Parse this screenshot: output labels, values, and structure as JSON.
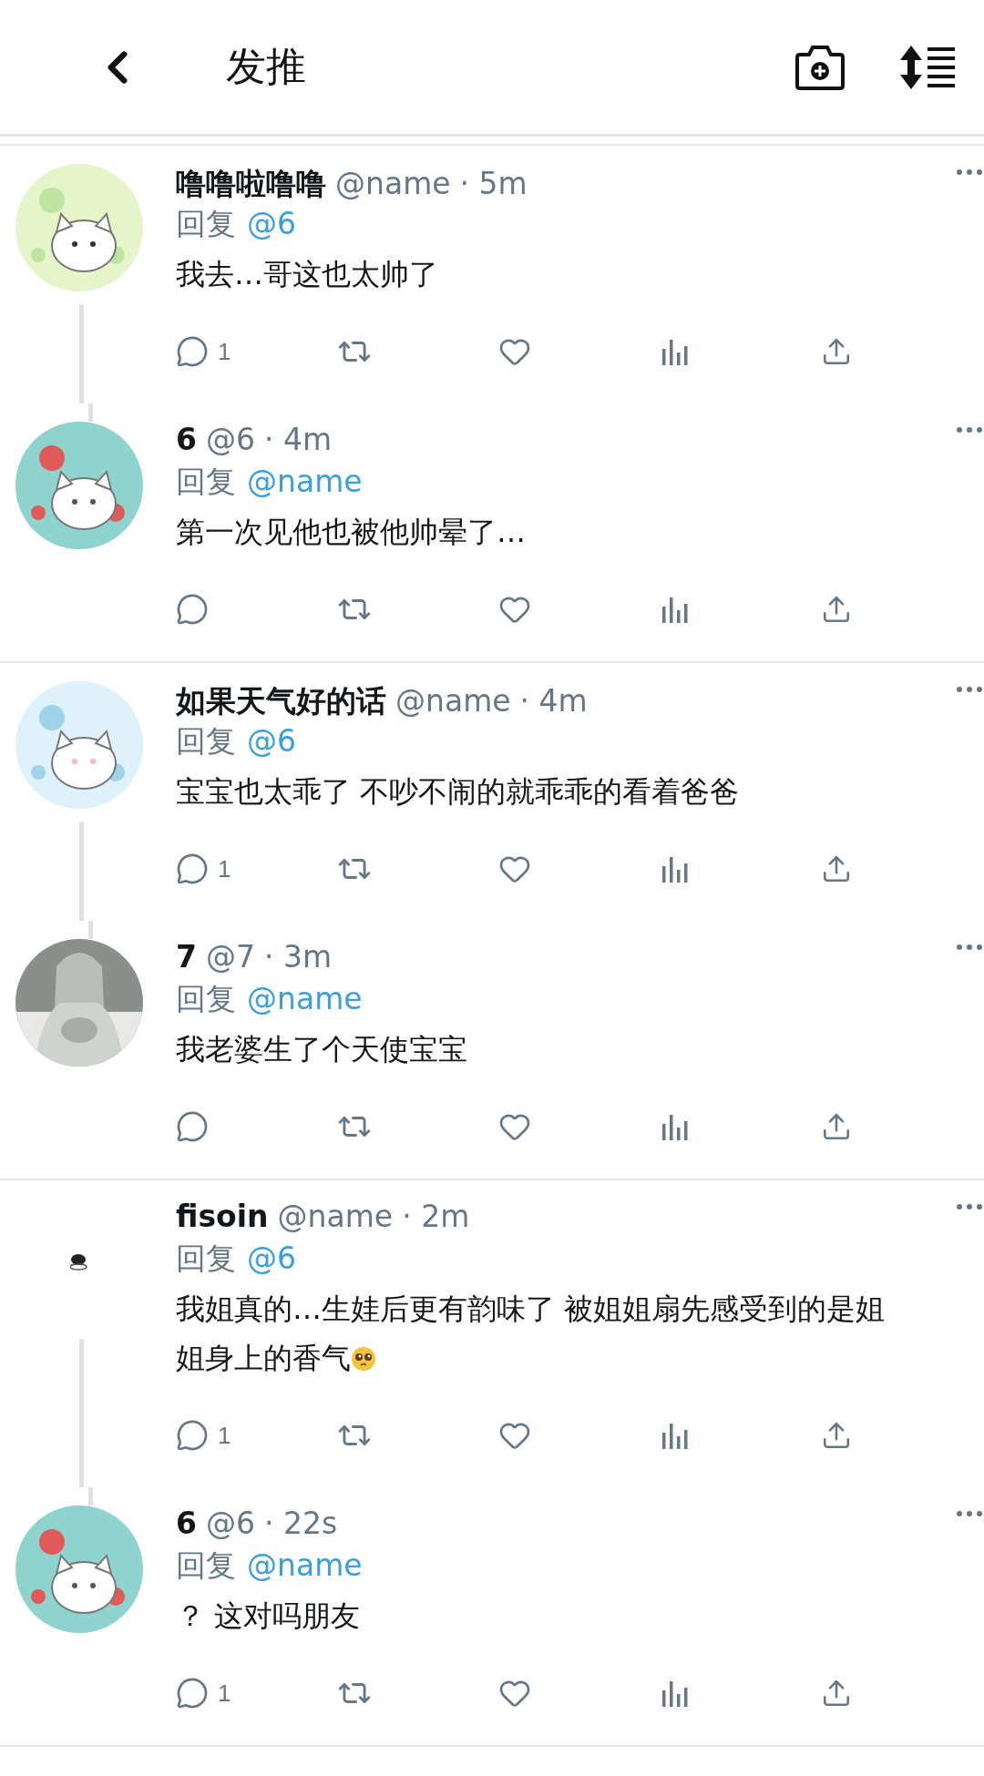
{
  "header": {
    "title": "发推"
  },
  "threads": [
    {
      "tweets": [
        {
          "name": "噜噜啦噜噜",
          "handle": "@name",
          "time": "· 5m",
          "reply_label": "回复",
          "reply_to": "@6",
          "text": "我去…哥这也太帅了",
          "reply_count": "1"
        },
        {
          "name": "6",
          "handle": "@6",
          "time": "· 4m",
          "reply_label": "回复",
          "reply_to": "@name",
          "text": "第一次见他也被他帅晕了…"
        }
      ]
    },
    {
      "tweets": [
        {
          "name": "如果天气好的话",
          "handle": "@name",
          "time": "· 4m",
          "reply_label": "回复",
          "reply_to": "@6",
          "text": "宝宝也太乖了 不吵不闹的就乖乖的看着爸爸",
          "reply_count": "1"
        },
        {
          "name": "7",
          "handle": "@7",
          "time": "· 3m",
          "reply_label": "回复",
          "reply_to": "@name",
          "text": "我老婆生了个天使宝宝"
        }
      ]
    },
    {
      "tweets": [
        {
          "name": "fisoin",
          "handle": "@name",
          "time": "· 2m",
          "reply_label": "回复",
          "reply_to": "@6",
          "text": "我姐真的…生娃后更有韵味了 被姐姐扇先感受到的是姐姐身上的香气",
          "emoji": true,
          "reply_count": "1"
        },
        {
          "name": "6",
          "handle": "@6",
          "time": "· 22s",
          "reply_label": "回复",
          "reply_to": "@name",
          "text": "？ 这对吗朋友",
          "reply_count": "1"
        }
      ]
    }
  ]
}
